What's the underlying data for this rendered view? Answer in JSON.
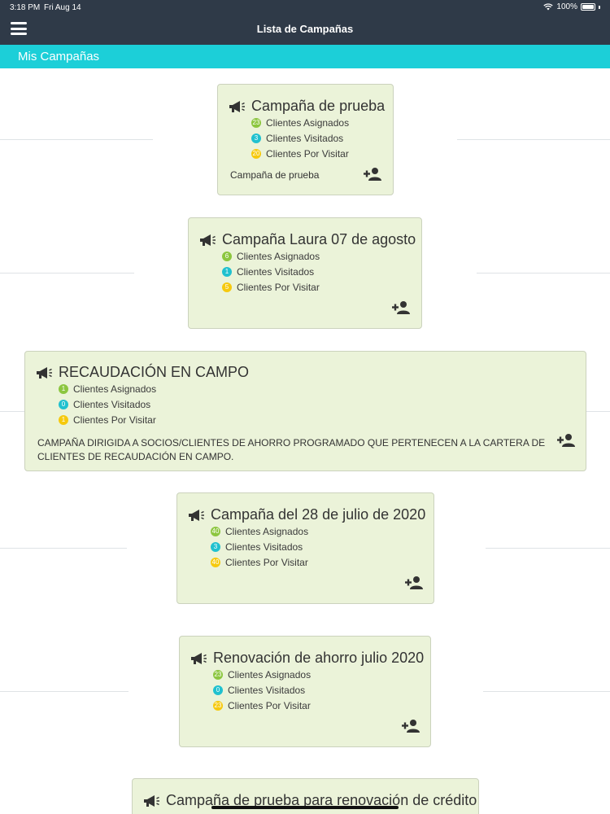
{
  "status_bar": {
    "time": "3:18 PM",
    "date": "Fri Aug 14",
    "battery": "100%"
  },
  "nav": {
    "title": "Lista de Campañas"
  },
  "subheader": {
    "title": "Mis Campañas"
  },
  "labels": {
    "assigned": "Clientes Asignados",
    "visited": "Clientes Visitados",
    "pending": "Clientes Por Visitar"
  },
  "campaigns": [
    {
      "title": "Campaña de prueba",
      "assigned": "23",
      "visited": "3",
      "pending": "20",
      "description": "Campaña de prueba"
    },
    {
      "title": "Campaña Laura 07 de agosto",
      "assigned": "6",
      "visited": "1",
      "pending": "5",
      "description": ""
    },
    {
      "title": "RECAUDACIÓN EN CAMPO",
      "assigned": "1",
      "visited": "0",
      "pending": "1",
      "description": "CAMPAÑA DIRIGIDA A SOCIOS/CLIENTES DE AHORRO PROGRAMADO QUE PERTENECEN A LA CARTERA DE CLIENTES DE RECAUDACIÓN EN CAMPO."
    },
    {
      "title": "Campaña del 28 de julio de 2020",
      "assigned": "40",
      "visited": "3",
      "pending": "40",
      "description": ""
    },
    {
      "title": "Renovación de ahorro julio 2020",
      "assigned": "23",
      "visited": "0",
      "pending": "23",
      "description": ""
    },
    {
      "title": "Campaña de prueba para renovación de crédito",
      "assigned": "",
      "visited": "",
      "pending": "",
      "description": ""
    }
  ],
  "colors": {
    "header": "#2f3a48",
    "accent": "#1ccfd8",
    "card_bg": "#ebf3d9",
    "assigned": "#8cc63f",
    "visited": "#20c1cf",
    "pending": "#f6c90e"
  },
  "icons": {
    "menu": "hamburger-icon",
    "campaign": "megaphone-icon",
    "add": "add-user-icon",
    "wifi": "wifi-icon",
    "battery": "battery-icon"
  }
}
